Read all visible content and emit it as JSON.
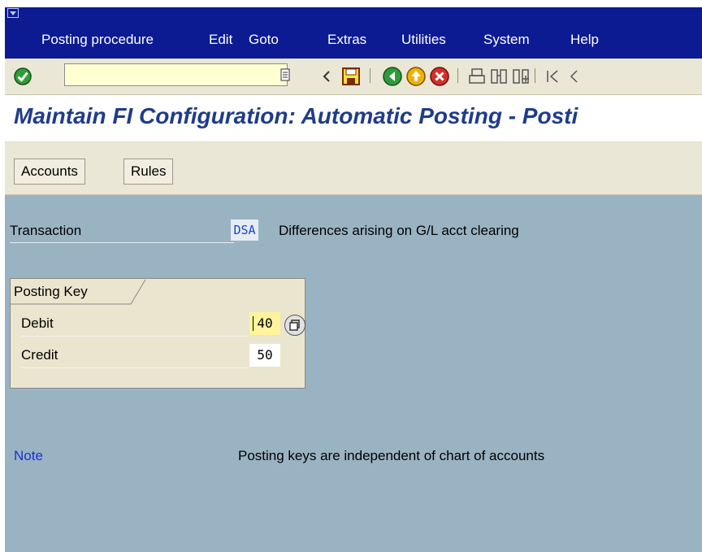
{
  "menu": {
    "items": [
      "Posting procedure",
      "Edit",
      "Goto",
      "Extras",
      "Utilities",
      "System",
      "Help"
    ]
  },
  "toolbar": {
    "command_value": "",
    "icons": [
      "enter-icon",
      "command-history-icon",
      "back-arrow-icon",
      "save-icon",
      "back-icon",
      "exit-icon",
      "cancel-icon",
      "print-icon",
      "find-icon",
      "find-next-icon",
      "first-page-icon",
      "previous-page-icon"
    ]
  },
  "title": "Maintain FI Configuration: Automatic Posting - Posti",
  "app_toolbar": {
    "accounts_label": "Accounts",
    "rules_label": "Rules"
  },
  "transaction": {
    "label": "Transaction",
    "code": "DSA",
    "description": "Differences arising on G/L acct clearing"
  },
  "posting_key": {
    "title": "Posting Key",
    "debit_label": "Debit",
    "debit_value": "40",
    "credit_label": "Credit",
    "credit_value": "50"
  },
  "note": {
    "label": "Note",
    "text": "Posting keys are independent of chart of accounts"
  },
  "colors": {
    "menubar": "#0c1b92",
    "toolbar": "#ebe7d6",
    "title_text": "#1f3c8c",
    "main_bg": "#9ab3c3",
    "note_label": "#1d2fd9"
  }
}
